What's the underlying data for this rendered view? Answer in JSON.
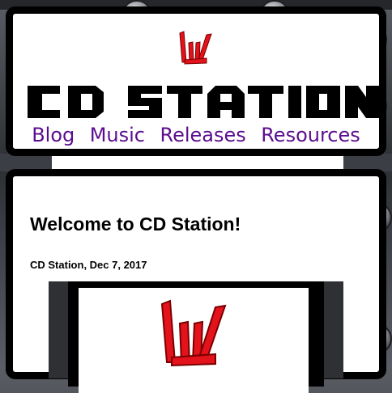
{
  "site": {
    "title": "CD STATION",
    "nav": [
      "Blog",
      "Music",
      "Releases",
      "Resources"
    ]
  },
  "post": {
    "title": "Welcome to CD Station!",
    "byline": "CD Station, Dec 7, 2017"
  },
  "colors": {
    "brand_red": "#e3121b",
    "nav_link": "#5b0d8f"
  },
  "icons": [
    "cd-station-logo-icon"
  ]
}
